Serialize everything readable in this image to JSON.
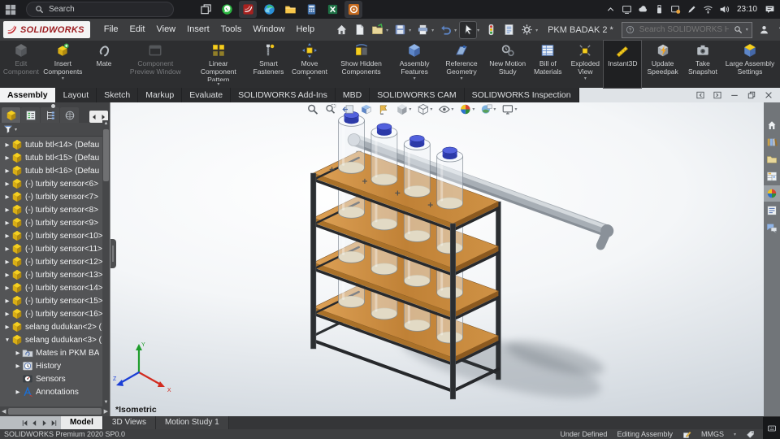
{
  "taskbar": {
    "search_label": "Search",
    "time": "23:10",
    "apps": [
      {
        "icon": "task-view"
      },
      {
        "icon": "whatsapp"
      },
      {
        "icon": "solidworks-app",
        "active": true
      },
      {
        "icon": "edge"
      },
      {
        "icon": "file-explorer-app"
      },
      {
        "icon": "calculator"
      },
      {
        "icon": "excel"
      },
      {
        "icon": "resource-monitor",
        "active": true
      }
    ],
    "tray": [
      {
        "icon": "chevron-up"
      },
      {
        "icon": "cast"
      },
      {
        "icon": "cloud"
      },
      {
        "icon": "usb"
      },
      {
        "icon": "snip"
      },
      {
        "icon": "pen"
      },
      {
        "icon": "wifi"
      },
      {
        "icon": "volume"
      }
    ]
  },
  "menubar": {
    "brand": "SOLIDWORKS",
    "menus": [
      {
        "label": "File"
      },
      {
        "label": "Edit"
      },
      {
        "label": "View"
      },
      {
        "label": "Insert"
      },
      {
        "label": "Tools"
      },
      {
        "label": "Window"
      },
      {
        "label": "Help"
      }
    ],
    "quick_access": [
      {
        "icon": "home-qa"
      },
      {
        "icon": "new-doc"
      },
      {
        "icon": "open-doc",
        "dropdown": true
      },
      {
        "icon": "save",
        "dropdown": true
      },
      {
        "icon": "print",
        "dropdown": true
      },
      {
        "icon": "undo",
        "dropdown": true
      },
      {
        "icon": "select-cursor",
        "active": true,
        "dropdown": true
      },
      {
        "icon": "rebuild"
      },
      {
        "icon": "file-props"
      },
      {
        "icon": "options-gear",
        "dropdown": true
      }
    ],
    "doc_title": "PKM BADAK 2 *",
    "help_search_placeholder": "Search SOLIDWORKS Help",
    "window_controls": [
      {
        "icon": "user"
      },
      {
        "icon": "help"
      },
      {
        "icon": "win-min"
      },
      {
        "icon": "win-restore"
      },
      {
        "icon": "win-close"
      }
    ]
  },
  "ribbon": {
    "buttons": [
      {
        "label": "Edit Component",
        "icon": "edit-component",
        "disabled": true
      },
      {
        "label": "Insert Components",
        "icon": "insert-components",
        "dropdown": true
      },
      {
        "label": "Mate",
        "icon": "mate"
      },
      {
        "label": "Component Preview Window",
        "icon": "component-preview-window",
        "disabled": true
      },
      {
        "label": "Linear Component Pattern",
        "icon": "linear-pattern",
        "dropdown": true
      },
      {
        "label": "Smart Fasteners",
        "icon": "smart-fasteners"
      },
      {
        "label": "Move Component",
        "icon": "move-component",
        "dropdown": true
      },
      {
        "label": "Show Hidden Components",
        "icon": "show-hidden"
      },
      {
        "label": "Assembly Features",
        "icon": "assembly-features",
        "dropdown": true
      },
      {
        "label": "Reference Geometry",
        "icon": "reference-geometry",
        "dropdown": true
      },
      {
        "label": "New Motion Study",
        "icon": "new-motion-study"
      },
      {
        "label": "Bill of Materials",
        "icon": "bill-of-materials"
      },
      {
        "label": "Exploded View",
        "icon": "exploded-view",
        "dropdown": true
      },
      {
        "label": "Instant3D",
        "icon": "instant3d",
        "active": true
      },
      {
        "label": "Update Speedpak",
        "icon": "update-speedpak"
      },
      {
        "label": "Take Snapshot",
        "icon": "take-snapshot"
      },
      {
        "label": "Large Assembly Settings",
        "icon": "large-assembly-settings"
      }
    ]
  },
  "command_tabs": [
    {
      "label": "Assembly",
      "active": true
    },
    {
      "label": "Layout"
    },
    {
      "label": "Sketch"
    },
    {
      "label": "Markup"
    },
    {
      "label": "Evaluate"
    },
    {
      "label": "SOLIDWORKS Add-Ins"
    },
    {
      "label": "MBD"
    },
    {
      "label": "SOLIDWORKS CAM"
    },
    {
      "label": "SOLIDWORKS Inspection"
    }
  ],
  "doc_window_controls": [
    {
      "icon": "doc-prev"
    },
    {
      "icon": "doc-next"
    },
    {
      "icon": "win-min"
    },
    {
      "icon": "win-restore"
    },
    {
      "icon": "win-close"
    }
  ],
  "tree": {
    "header_tabs": [
      {
        "icon": "fm-assembly",
        "active": true
      },
      {
        "icon": "fm-property"
      },
      {
        "icon": "fm-config"
      },
      {
        "icon": "fm-dimxpert"
      }
    ],
    "items": [
      {
        "arrow": "▶",
        "icon": "part",
        "label": "tutub btl<14> (Defau"
      },
      {
        "arrow": "▶",
        "icon": "part",
        "label": "tutub btl<15> (Defau"
      },
      {
        "arrow": "▶",
        "icon": "part",
        "label": "tutub btl<16> (Defau"
      },
      {
        "arrow": "▶",
        "icon": "part",
        "label": "(-) turbity sensor<6>"
      },
      {
        "arrow": "▶",
        "icon": "part",
        "label": "(-) turbity sensor<7>"
      },
      {
        "arrow": "▶",
        "icon": "part",
        "label": "(-) turbity sensor<8>"
      },
      {
        "arrow": "▶",
        "icon": "part",
        "label": "(-) turbity sensor<9>"
      },
      {
        "arrow": "▶",
        "icon": "part",
        "label": "(-) turbity sensor<10>"
      },
      {
        "arrow": "▶",
        "icon": "part",
        "label": "(-) turbity sensor<11>"
      },
      {
        "arrow": "▶",
        "icon": "part",
        "label": "(-) turbity sensor<12>"
      },
      {
        "arrow": "▶",
        "icon": "part",
        "label": "(-) turbity sensor<13>"
      },
      {
        "arrow": "▶",
        "icon": "part",
        "label": "(-) turbity sensor<14>"
      },
      {
        "arrow": "▶",
        "icon": "part",
        "label": "(-) turbity sensor<15>"
      },
      {
        "arrow": "▶",
        "icon": "part",
        "label": "(-) turbity sensor<16>"
      },
      {
        "arrow": "▶",
        "icon": "part",
        "label": "selang dudukan<2> ("
      },
      {
        "arrow": "▼",
        "icon": "part",
        "label": "selang dudukan<3> ("
      },
      {
        "arrow": "▶",
        "icon": "mates-folder",
        "label": "Mates in PKM BA",
        "level": 1
      },
      {
        "arrow": "▶",
        "icon": "history",
        "label": "History",
        "level": 1
      },
      {
        "arrow": "",
        "icon": "sensors",
        "label": "Sensors",
        "level": 1
      },
      {
        "arrow": "▶",
        "icon": "annotations",
        "label": "Annotations",
        "level": 1
      }
    ]
  },
  "viewport": {
    "view_label": "*Isometric",
    "triad": {
      "x": "X",
      "y": "Y",
      "z": "Z"
    },
    "headsup": [
      {
        "icon": "zoom-fit"
      },
      {
        "icon": "zoom-area"
      },
      {
        "icon": "previous-view"
      },
      {
        "icon": "section-view"
      },
      {
        "icon": "annotation-views"
      },
      {
        "icon": "view-orientation",
        "dropdown": true
      },
      {
        "icon": "display-style",
        "dropdown": true
      },
      {
        "icon": "hide-show",
        "dropdown": true
      },
      {
        "icon": "edit-appearance",
        "dropdown": true
      },
      {
        "icon": "apply-scene",
        "dropdown": true
      },
      {
        "icon": "view-settings",
        "dropdown": true
      }
    ]
  },
  "taskpane": [
    {
      "icon": "home"
    },
    {
      "icon": "design-library"
    },
    {
      "icon": "file-explorer-pane"
    },
    {
      "icon": "view-palette"
    },
    {
      "icon": "appearances",
      "active": true
    },
    {
      "icon": "custom-properties"
    },
    {
      "icon": "forum"
    }
  ],
  "doctabs": [
    {
      "label": "Model",
      "active": true
    },
    {
      "label": "3D Views"
    },
    {
      "label": "Motion Study 1"
    }
  ],
  "statusbar": {
    "left": "SOLIDWORKS Premium 2020 SP0.0",
    "state": "Under Defined",
    "mode": "Editing Assembly",
    "units": "MMGS"
  }
}
